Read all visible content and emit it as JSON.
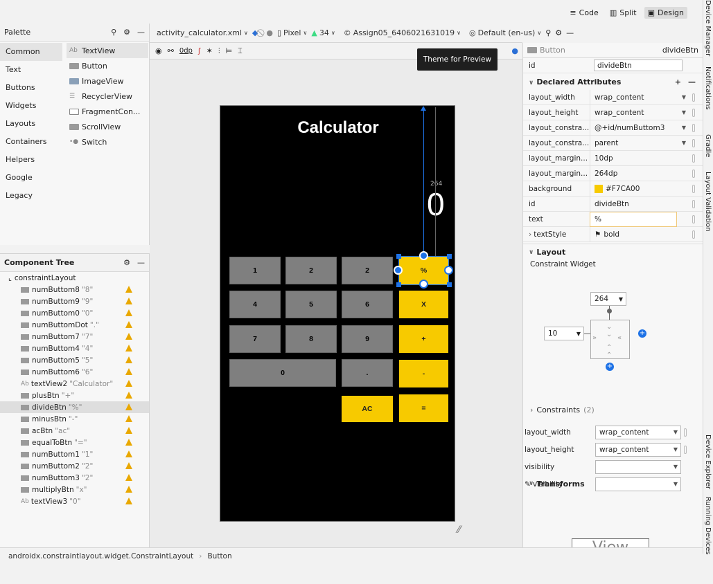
{
  "view_modes": {
    "code": "Code",
    "split": "Split",
    "design": "Design"
  },
  "side_tools": [
    "Device Manager",
    "Notifications",
    "Gradle",
    "Layout Validation",
    "Device Explorer",
    "Running Devices"
  ],
  "palette": {
    "title": "Palette",
    "categories": [
      "Common",
      "Text",
      "Buttons",
      "Widgets",
      "Layouts",
      "Containers",
      "Helpers",
      "Google",
      "Legacy"
    ],
    "items": [
      {
        "label": "TextView",
        "icon": "Ab"
      },
      {
        "label": "Button",
        "icon": "button-icon"
      },
      {
        "label": "ImageView",
        "icon": "image-icon"
      },
      {
        "label": "RecyclerView",
        "icon": "list-icon"
      },
      {
        "label": "FragmentCon...",
        "icon": "fragment-icon"
      },
      {
        "label": "ScrollView",
        "icon": "scroll-icon"
      },
      {
        "label": "Switch",
        "icon": "switch-icon"
      }
    ]
  },
  "component_tree": {
    "title": "Component Tree",
    "root": "constraintLayout",
    "rows": [
      {
        "name": "numButtom8",
        "text": "\"8\""
      },
      {
        "name": "numButtom9",
        "text": "\"9\""
      },
      {
        "name": "numButtom0",
        "text": "\"0\""
      },
      {
        "name": "numButtomDot",
        "text": "\".\""
      },
      {
        "name": "numButtom7",
        "text": "\"7\""
      },
      {
        "name": "numButtom4",
        "text": "\"4\""
      },
      {
        "name": "numButtom5",
        "text": "\"5\""
      },
      {
        "name": "numButtom6",
        "text": "\"6\""
      },
      {
        "name": "textView2",
        "text": "\"Calculator\"",
        "icon": "Ab"
      },
      {
        "name": "plusBtn",
        "text": "\"+\""
      },
      {
        "name": "divideBtn",
        "text": "\"%\"",
        "selected": true
      },
      {
        "name": "minusBtn",
        "text": "\"-\""
      },
      {
        "name": "acBtn",
        "text": "\"ac\""
      },
      {
        "name": "equalToBtn",
        "text": "\"=\""
      },
      {
        "name": "numButtom1",
        "text": "\"1\""
      },
      {
        "name": "numButtom2",
        "text": "\"2\""
      },
      {
        "name": "numButtom3",
        "text": "\"2\""
      },
      {
        "name": "multiplyBtn",
        "text": "\"x\""
      },
      {
        "name": "textView3",
        "text": "\"0\"",
        "icon": "Ab"
      }
    ]
  },
  "editor_toolbar": {
    "file": "activity_calculator.xml",
    "device": "Pixel",
    "api": "34",
    "theme": "Assign05_6406021631019",
    "locale": "Default (en-us)",
    "margin": "0dp"
  },
  "tooltip": "Theme for Preview",
  "preview": {
    "title": "Calculator",
    "result": "0",
    "margin_label": "264",
    "keys": [
      "1",
      "2",
      "2",
      "%",
      "4",
      "5",
      "6",
      "X",
      "7",
      "8",
      "9",
      "+",
      "0",
      ".",
      "-",
      "AC",
      "="
    ]
  },
  "attributes": {
    "type": "Button",
    "id_label": "id",
    "id_value": "divideBtn",
    "declared_title": "Declared Attributes",
    "declared": [
      {
        "key": "layout_width",
        "value": "wrap_content"
      },
      {
        "key": "layout_height",
        "value": "wrap_content"
      },
      {
        "key": "layout_constra...",
        "value": "@+id/numButtom3"
      },
      {
        "key": "layout_constra...",
        "value": "parent"
      },
      {
        "key": "layout_margin...",
        "value": "10dp"
      },
      {
        "key": "layout_margin...",
        "value": "264dp"
      },
      {
        "key": "background",
        "value": "#F7CA00"
      },
      {
        "key": "id",
        "value": "divideBtn"
      },
      {
        "key": "text",
        "value": "%"
      },
      {
        "key": "textStyle",
        "value": "bold"
      }
    ],
    "layout_title": "Layout",
    "constraint_widget": "Constraint Widget",
    "top_margin": "264",
    "left_margin": "10",
    "constraints_label": "Constraints",
    "constraints_count": "(2)",
    "layout_rows": [
      {
        "key": "layout_width",
        "value": "wrap_content"
      },
      {
        "key": "layout_height",
        "value": "wrap_content"
      },
      {
        "key": "visibility",
        "value": ""
      },
      {
        "key": "visibility",
        "value": ""
      }
    ],
    "transforms_title": "Transforms",
    "view_label": "View"
  },
  "status": {
    "path": "androidx.constraintlayout.widget.ConstraintLayout",
    "leaf": "Button"
  },
  "colors": {
    "accent": "#F7CA00",
    "selection": "#1e72e6"
  }
}
